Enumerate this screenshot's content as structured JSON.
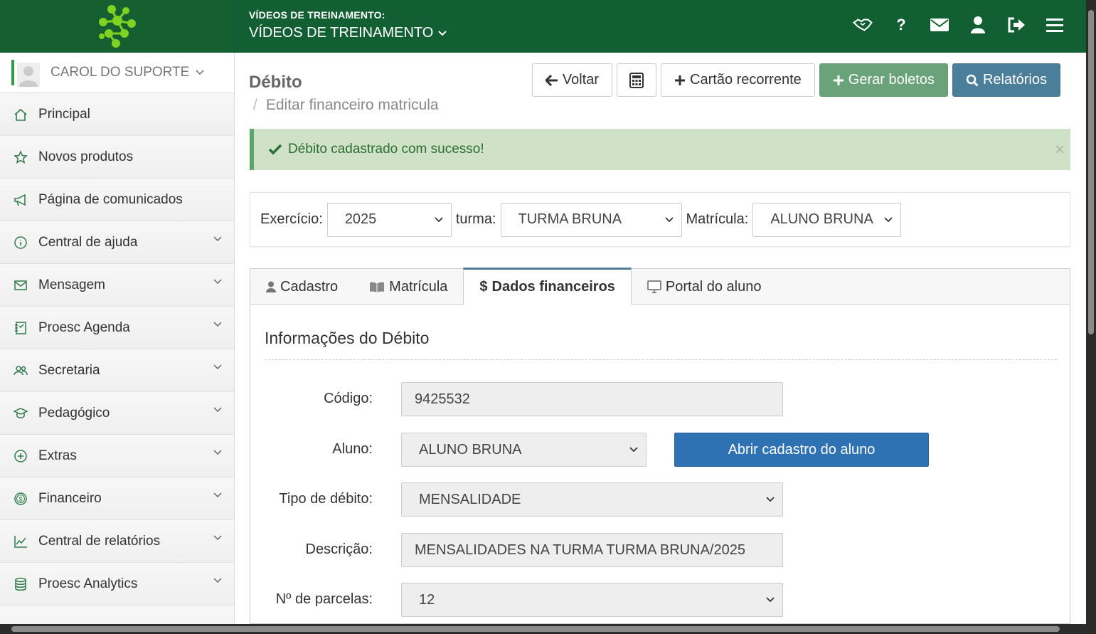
{
  "header": {
    "subtitle": "VÍDEOS DE TREINAMENTO:",
    "title": "VÍDEOS DE TREINAMENTO",
    "icons": [
      "handshake-icon",
      "help-icon",
      "envelope-icon",
      "user-icon",
      "logout-icon",
      "hamburger-icon"
    ],
    "help_glyph": "?"
  },
  "sidebar": {
    "user_name": "CAROL DO SUPORTE",
    "items": [
      {
        "label": "Principal",
        "icon": "home-icon"
      },
      {
        "label": "Novos produtos",
        "icon": "star-icon"
      },
      {
        "label": "Página de comunicados",
        "icon": "megaphone-icon"
      },
      {
        "label": "Central de ajuda",
        "icon": "info-icon"
      },
      {
        "label": "Mensagem",
        "icon": "envelope-icon"
      },
      {
        "label": "Proesc Agenda",
        "icon": "agenda-icon"
      },
      {
        "label": "Secretaria",
        "icon": "users-icon"
      },
      {
        "label": "Pedagógico",
        "icon": "graduation-icon"
      },
      {
        "label": "Extras",
        "icon": "plus-circle-icon"
      },
      {
        "label": "Financeiro",
        "icon": "dollar-circle-icon"
      },
      {
        "label": "Central de relatórios",
        "icon": "chart-line-icon"
      },
      {
        "label": "Proesc Analytics",
        "icon": "database-icon"
      }
    ]
  },
  "page": {
    "title": "Débito",
    "breadcrumb_sep": "/",
    "breadcrumb": "Editar financeiro matricula"
  },
  "toolbar": {
    "back": "Voltar",
    "recurring_card": "Cartão recorrente",
    "generate_slips": "Gerar boletos",
    "reports": "Relatórios"
  },
  "alert": {
    "message": "Débito cadastrado com sucesso!",
    "close": "×"
  },
  "filters": {
    "exercicio_label": "Exercício:",
    "exercicio_value": "2025",
    "turma_label": "turma:",
    "turma_value": "TURMA BRUNA",
    "matricula_label": "Matrícula:",
    "matricula_value": "ALUNO BRUNA"
  },
  "tabs": [
    {
      "label": "Cadastro",
      "icon": "user-icon"
    },
    {
      "label": "Matrícula",
      "icon": "book-icon"
    },
    {
      "label": "Dados financeiros",
      "icon": "dollar-icon",
      "prefix": "$"
    },
    {
      "label": "Portal do aluno",
      "icon": "monitor-icon"
    }
  ],
  "form": {
    "section_title": "Informações do Débito",
    "codigo_label": "Código:",
    "codigo_value": "9425532",
    "aluno_label": "Aluno:",
    "aluno_value": "ALUNO BRUNA",
    "open_student_button": "Abrir cadastro do aluno",
    "tipo_label": "Tipo de débito:",
    "tipo_value": "MENSALIDADE",
    "descricao_label": "Descrição:",
    "descricao_value": "MENSALIDADES NA TURMA TURMA BRUNA/2025",
    "parcelas_label": "Nº de parcelas:",
    "parcelas_value": "12"
  },
  "colors": {
    "header_green": "#125f34",
    "success_bg": "#cfe1c6",
    "primary_blue": "#2f72b3",
    "generate_green": "#6aa37a",
    "reports_blue": "#4b7e98"
  }
}
